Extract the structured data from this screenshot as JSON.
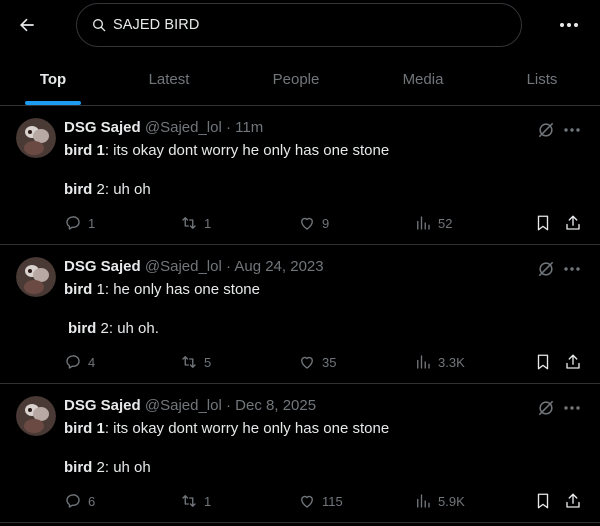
{
  "search": {
    "query": "SAJED BIRD"
  },
  "tabs": [
    {
      "label": "Top"
    },
    {
      "label": "Latest"
    },
    {
      "label": "People"
    },
    {
      "label": "Media"
    },
    {
      "label": "Lists"
    }
  ],
  "colors": {
    "accent": "#1d9bf0",
    "text": "#e7e9ea",
    "muted": "#71767b",
    "border": "#2f3336",
    "background": "#000000"
  },
  "tweets": [
    {
      "name": "DSG Sajed",
      "handle": "@Sajed_lol",
      "sep": "·",
      "time": "11m",
      "line1_bold": "bird 1",
      "line1_text": ": its okay dont worry he only has one stone",
      "line2_bold": "bird",
      "line2_text": " 2: uh oh",
      "replies": "1",
      "reposts": "1",
      "likes": "9",
      "views": "52"
    },
    {
      "name": "DSG Sajed",
      "handle": "@Sajed_lol",
      "sep": "·",
      "time": "Aug 24, 2023",
      "line1_bold": "bird",
      "line1_text": " 1: he only has one stone",
      "line2_bold": "bird",
      "line2_text": " 2: uh oh.",
      "replies": "4",
      "reposts": "5",
      "likes": "35",
      "views": "3.3K"
    },
    {
      "name": "DSG Sajed",
      "handle": "@Sajed_lol",
      "sep": "·",
      "time": "Dec 8, 2025",
      "line1_bold": "bird 1",
      "line1_text": ": its okay dont worry he only has one stone",
      "line2_bold": "bird",
      "line2_text": " 2: uh oh",
      "replies": "6",
      "reposts": "1",
      "likes": "115",
      "views": "5.9K"
    }
  ]
}
